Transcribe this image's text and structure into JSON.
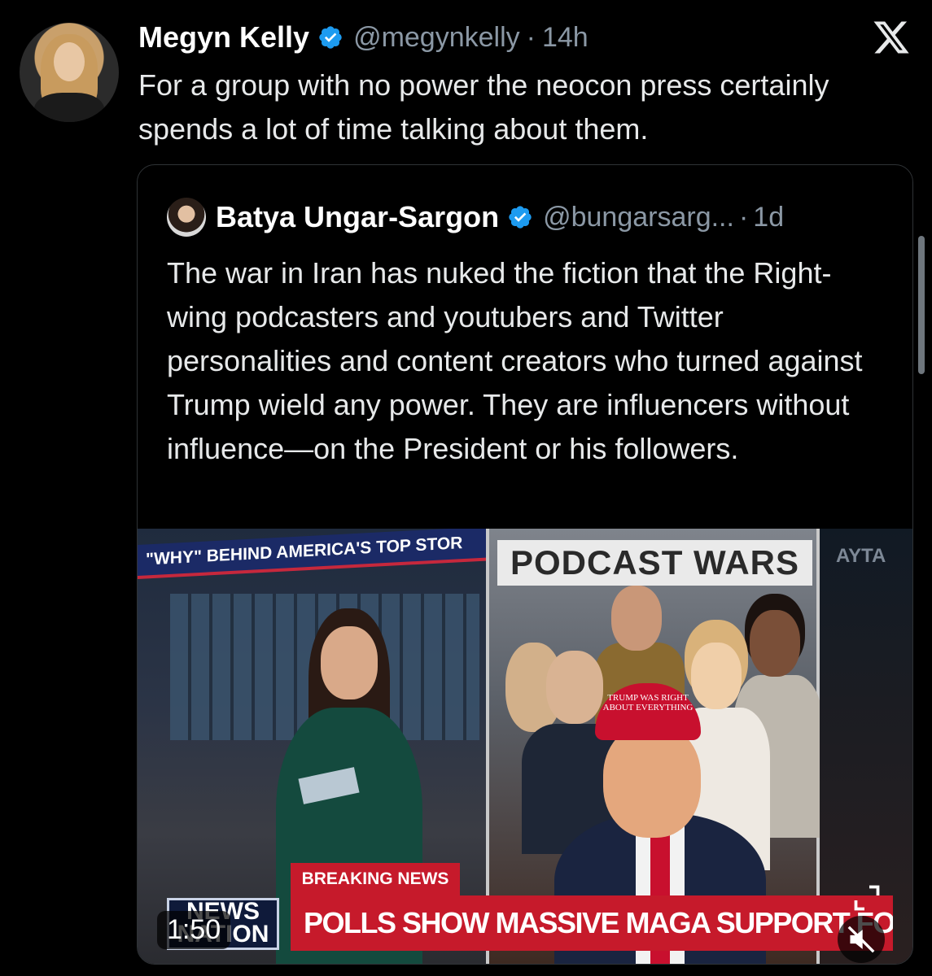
{
  "tweet": {
    "author_name": "Megyn Kelly",
    "handle": "@megynkelly",
    "separator": "·",
    "time": "14h",
    "text": "For a group with no power the neocon press certainly spends a lot of time talking about them."
  },
  "quoted_tweet": {
    "author_name": "Batya Ungar-Sargon",
    "handle": "@bungarsarg...",
    "separator": "·",
    "time": "1d",
    "text": "The war in Iran has nuked the fiction that the Right-wing podcasters and youtubers and Twitter personalities and content creators who turned against Trump wield any power. They are influencers without influence—on the President or his followers."
  },
  "video": {
    "studio_banner": "\"WHY\" BEHIND AMERICA'S TOP STOR",
    "panel_title": "PODCAST WARS",
    "cap_text": "TRUMP WAS RIGHT ABOUT EVERYTHING",
    "studio_sign": "AYTA",
    "breaking_label": "BREAKING NEWS",
    "headline": "POLLS SHOW MASSIVE MAGA SUPPORT FOR TRUMP",
    "network_logo_line1": "NEWS",
    "network_logo_line2": "NATION",
    "duration": "1:50"
  },
  "icons": {
    "verified": "verified-badge-icon",
    "x_logo": "x-logo-icon",
    "mute": "mute-icon",
    "expand": "expand-icon"
  },
  "colors": {
    "background": "#000000",
    "text": "#e7e9ea",
    "secondary_text": "#8b98a5",
    "verified_blue": "#1d9bf0",
    "news_red": "#c61a2b"
  }
}
